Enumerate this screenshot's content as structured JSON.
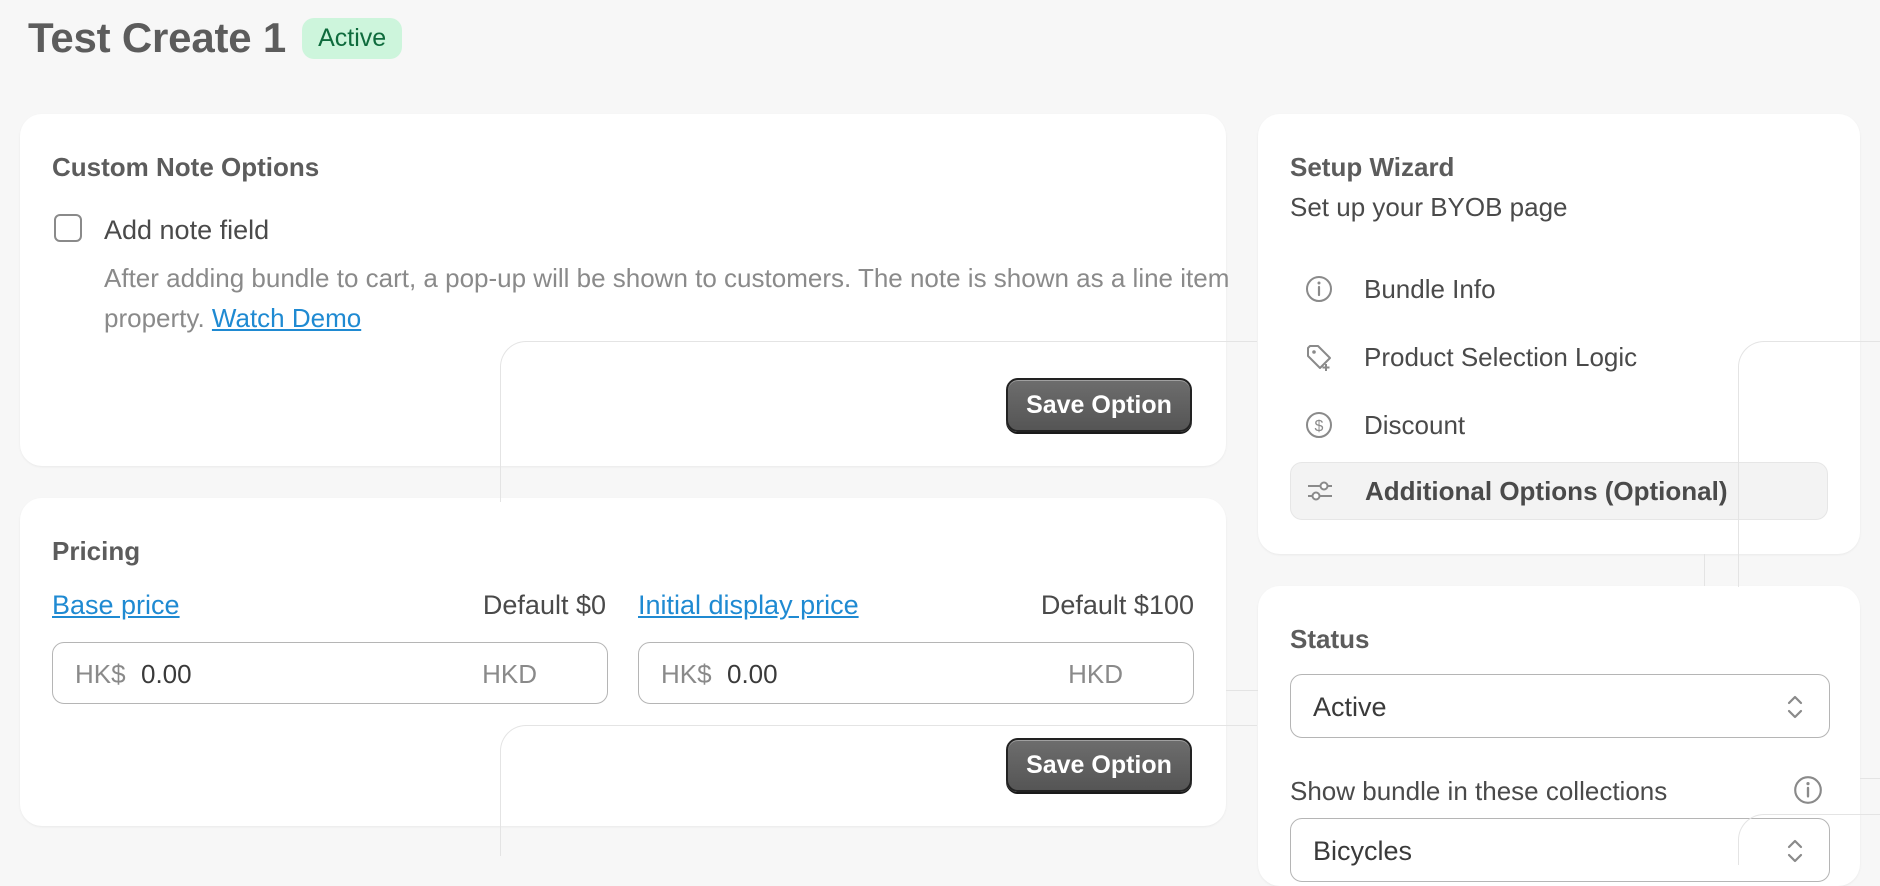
{
  "header": {
    "title": "Test Create 1",
    "status_badge": "Active"
  },
  "note_card": {
    "title": "Custom Note Options",
    "checkbox_label": "Add note field",
    "checked": false,
    "help_text": "After adding bundle to cart, a pop-up will be shown to customers. The note is shown as a line item property.",
    "help_link": "Watch Demo",
    "save_label": "Save Option"
  },
  "pricing_card": {
    "title": "Pricing",
    "base": {
      "label": "Base price",
      "default": "Default $0",
      "prefix": "HK$",
      "value": "0.00",
      "suffix": "HKD"
    },
    "initial": {
      "label": "Initial display price",
      "default": "Default $100",
      "prefix": "HK$",
      "value": "0.00",
      "suffix": "HKD"
    },
    "save_label": "Save Option"
  },
  "wizard": {
    "title": "Setup Wizard",
    "subtitle": "Set up your BYOB page",
    "items": [
      {
        "label": "Bundle Info",
        "icon": "info-icon"
      },
      {
        "label": "Product Selection Logic",
        "icon": "tag-plus-icon"
      },
      {
        "label": "Discount",
        "icon": "dollar-circle-icon"
      },
      {
        "label": "Additional Options (Optional)",
        "icon": "sliders-icon",
        "active": true
      }
    ]
  },
  "status_card": {
    "title": "Status",
    "status_value": "Active",
    "collections_label": "Show bundle in these collections",
    "collections_value": "Bicycles"
  },
  "colors": {
    "badge_bg": "#cdf5dc",
    "badge_text": "#0f6b3d",
    "link": "#1f8ad2",
    "button": "#5f5f5f"
  }
}
